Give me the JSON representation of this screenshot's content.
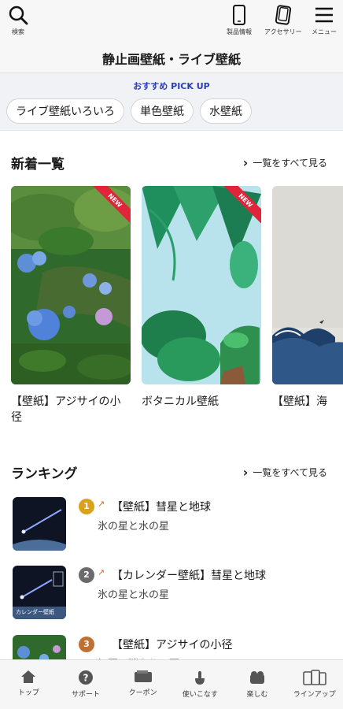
{
  "header": {
    "search_label": "検索",
    "product_label": "製品情報",
    "accessory_label": "アクセサリー",
    "menu_label": "メニュー",
    "title": "静止画壁紙・ライブ壁紙"
  },
  "pickup": {
    "label": "おすすめ PICK UP",
    "chips": [
      "ライブ壁紙いろいろ",
      "単色壁紙",
      "水壁紙"
    ]
  },
  "new_section": {
    "title": "新着一覧",
    "see_all": "一覧をすべて見る",
    "badge": "NEW",
    "items": [
      {
        "caption": "【壁紙】アジサイの小径"
      },
      {
        "caption": "ボタニカル壁紙"
      },
      {
        "caption": "【壁紙】海"
      }
    ]
  },
  "ranking_section": {
    "title": "ランキング",
    "see_all": "一覧をすべて見る",
    "thumb_overlay": "カレンダー壁紙",
    "items": [
      {
        "rank": "1",
        "title": "【壁紙】彗星と地球",
        "subtitle": "氷の星と水の星"
      },
      {
        "rank": "2",
        "title": "【カレンダー壁紙】彗星と地球",
        "subtitle": "氷の星と水の星"
      },
      {
        "rank": "3",
        "title": "【壁紙】アジサイの小径",
        "subtitle": "初夏の瑞々しい雨"
      }
    ]
  },
  "bottom_nav": {
    "items": [
      {
        "label": "トップ"
      },
      {
        "label": "サポート"
      },
      {
        "label": "クーポン"
      },
      {
        "label": "使いこなす"
      },
      {
        "label": "楽しむ"
      },
      {
        "label": "ラインアップ"
      }
    ]
  },
  "colors": {
    "accent": "#2a3fb8",
    "new_badge": "#e0243a",
    "rank1": "#d9a21a",
    "rank2": "#6b6b6b",
    "rank3": "#c07030",
    "trend": "#e06a2a"
  }
}
